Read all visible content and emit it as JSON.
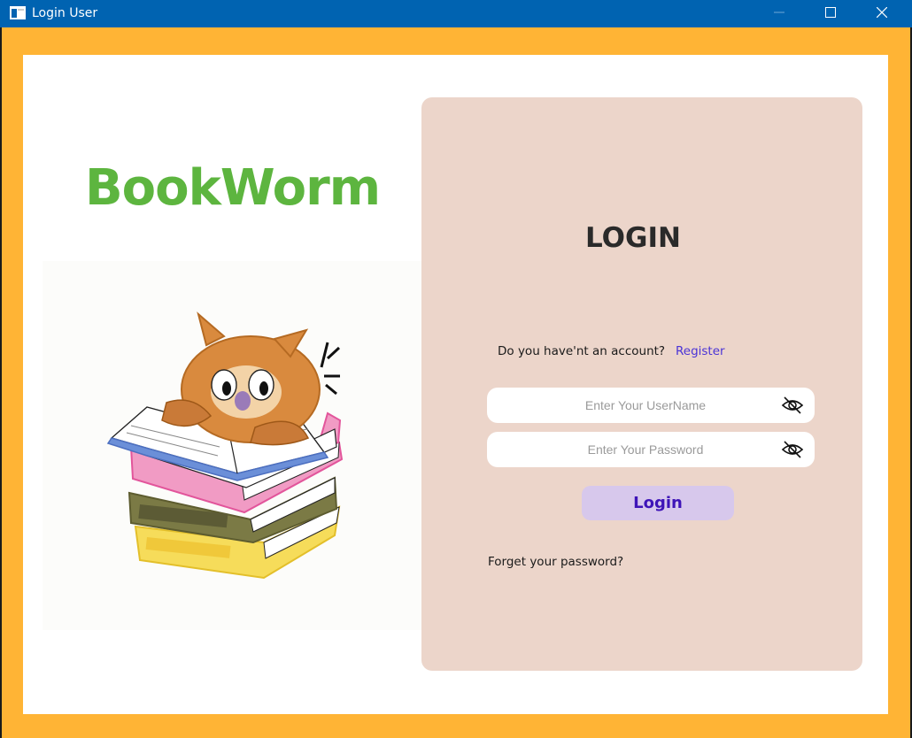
{
  "window": {
    "title": "Login User",
    "controls": {
      "minimize": "minimize-icon",
      "maximize": "maximize-icon",
      "close": "close-icon"
    }
  },
  "brand": {
    "name": "BookWorm",
    "color": "#5DB53F"
  },
  "illustration": {
    "description_icon": "owl-reading-books-icon"
  },
  "login": {
    "heading": "LOGIN",
    "account_prompt": "Do you have'nt an account?",
    "register_label": "Register",
    "username_placeholder": "Enter Your UserName",
    "password_placeholder": "Enter Your Password",
    "toggle_icon": "eye-slash-icon",
    "button_label": "Login",
    "forgot_label": "Forget your password?"
  },
  "colors": {
    "frame": "#FFB435",
    "titlebar": "#0063B1",
    "card": "#ECD5CA",
    "button_bg": "#D7C8EC",
    "button_text": "#3E14B8",
    "link": "#4A33D6"
  }
}
